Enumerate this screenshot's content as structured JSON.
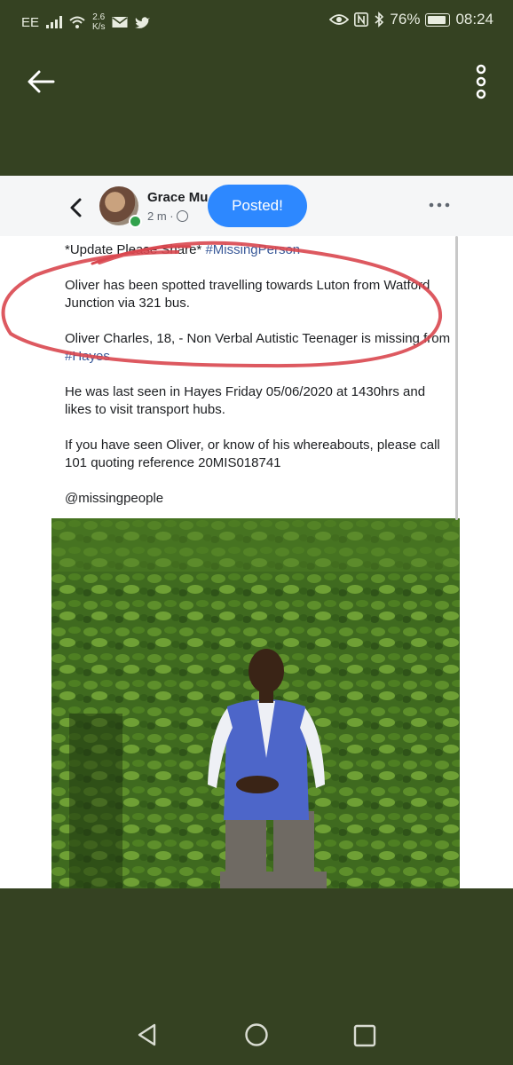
{
  "status_bar": {
    "carrier": "EE",
    "speed_value": "2.6",
    "speed_unit": "K/s",
    "battery": "76%",
    "time": "08:24"
  },
  "post": {
    "author": "Grace Mu",
    "time": "2 m ·",
    "toast": "Posted!",
    "line1_prefix": "*Update Please Share* ",
    "line1_tag": "#MissingPerson",
    "para1": "Oliver has been spotted travelling towards Luton from Watford Junction via 321 bus.",
    "para2_prefix": "Oliver Charles, 18, - Non Verbal Autistic Teenager is missing from ",
    "para2_tag": "#Hayes",
    "para3": "He was last seen in Hayes Friday 05/06/2020 at 1430hrs and likes to visit transport hubs.",
    "para4": "If you have seen Oliver, or know of his whereabouts, please call 101 quoting reference 20MIS018741",
    "para5": "@missingpeople"
  },
  "colors": {
    "background": "#354222",
    "toast": "#2d88ff",
    "link": "#385898",
    "annotation": "#d9474f"
  },
  "icons": {
    "back": "arrow-left-icon",
    "more": "vertical-dots-icon",
    "nav_back": "triangle-back-icon",
    "nav_home": "circle-home-icon",
    "nav_recent": "square-recents-icon"
  }
}
